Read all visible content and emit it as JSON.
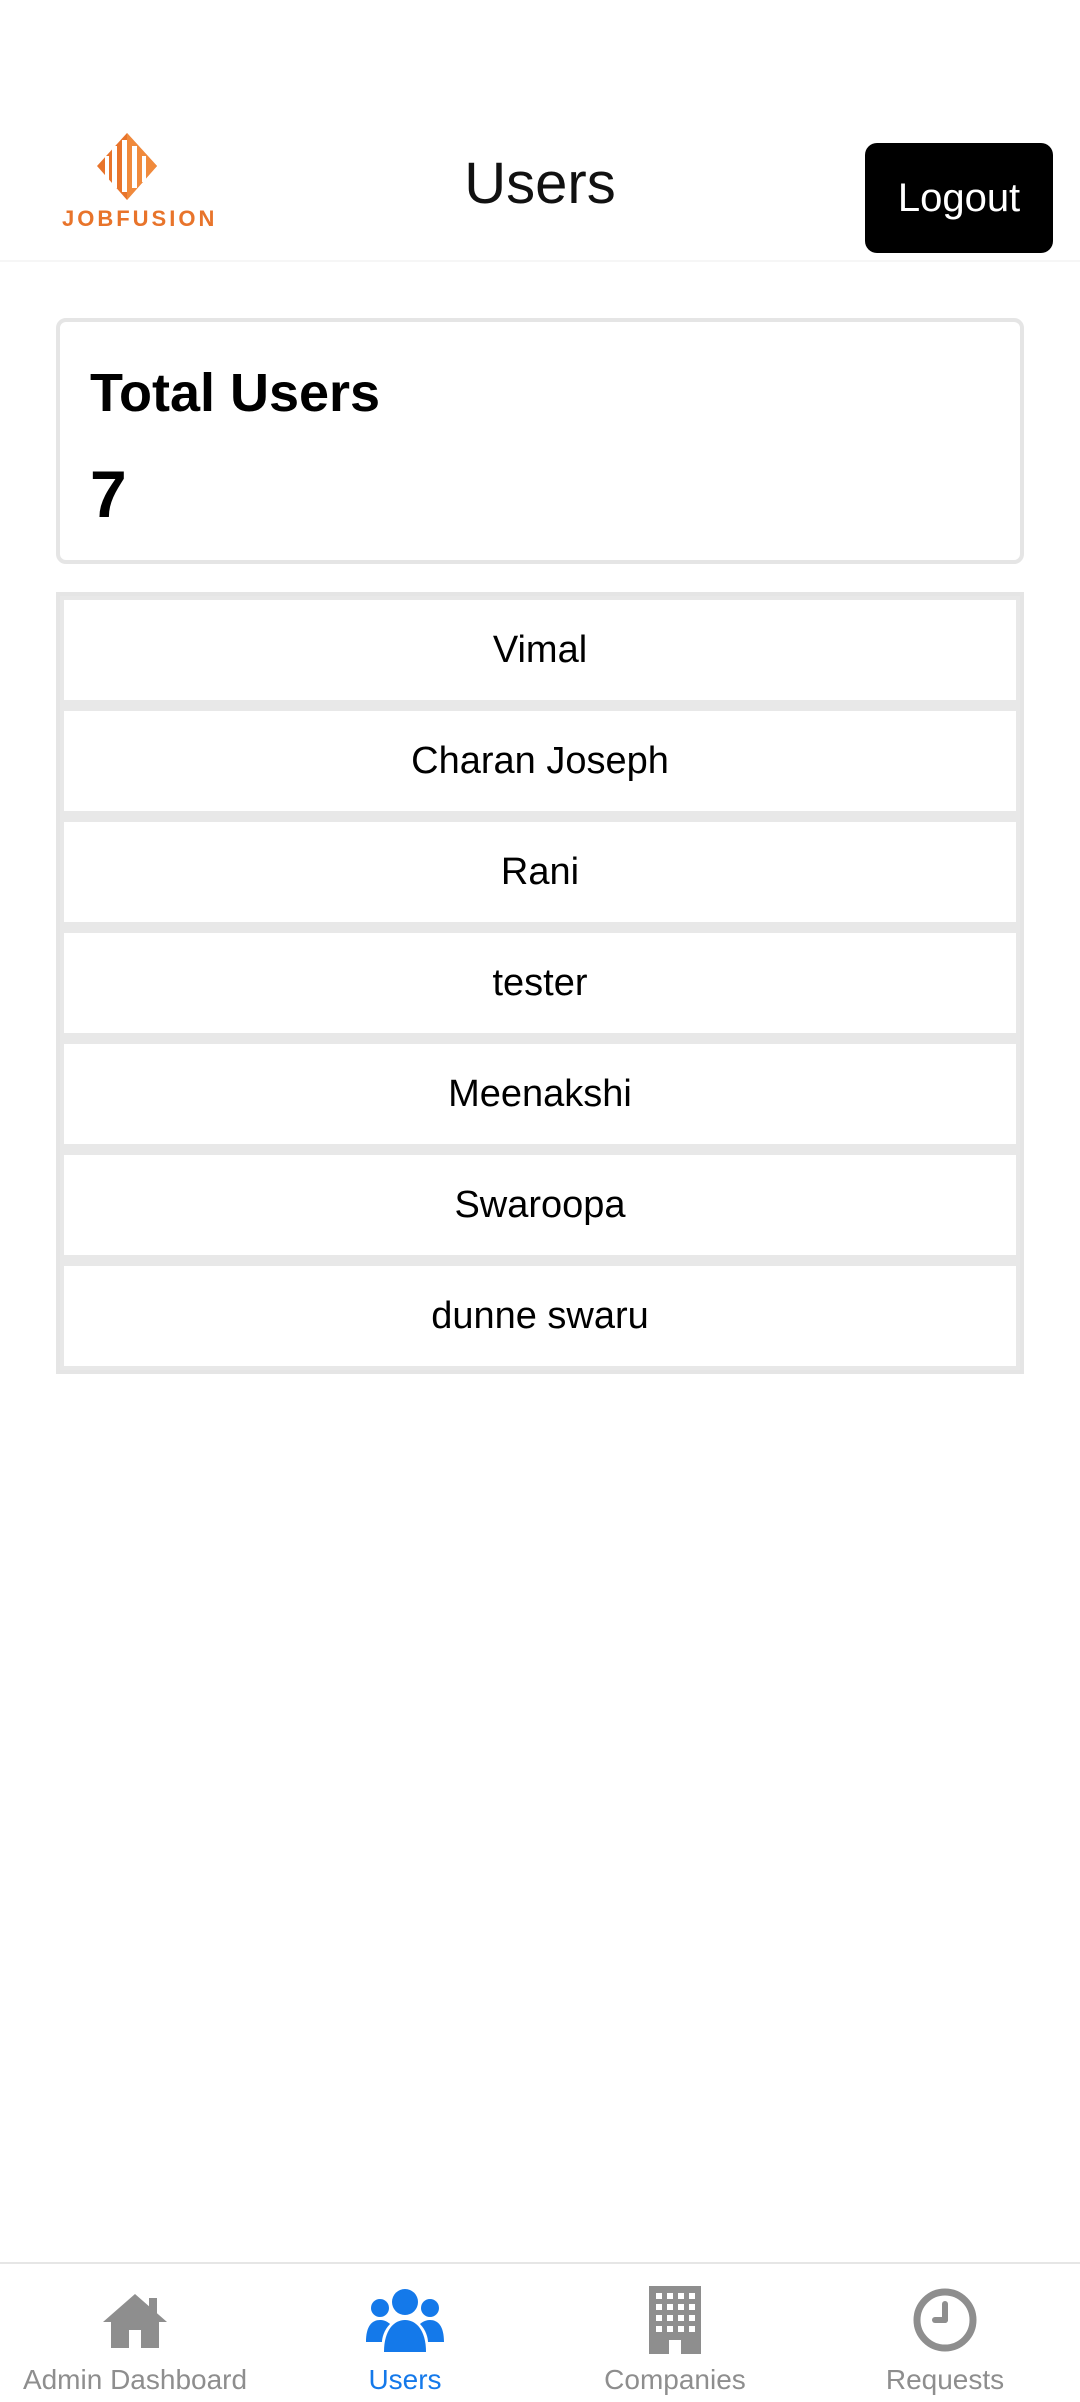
{
  "header": {
    "logo_text": "JOBFUSION",
    "title": "Users",
    "logout_label": "Logout"
  },
  "stats": {
    "label": "Total Users",
    "value": "7"
  },
  "users": [
    {
      "name": "Vimal"
    },
    {
      "name": "Charan Joseph"
    },
    {
      "name": "Rani"
    },
    {
      "name": "tester"
    },
    {
      "name": "Meenakshi"
    },
    {
      "name": "Swaroopa"
    },
    {
      "name": "dunne swaru"
    }
  ],
  "nav": {
    "items": [
      {
        "label": "Admin Dashboard",
        "icon": "home-icon"
      },
      {
        "label": "Users",
        "icon": "users-icon",
        "active": true
      },
      {
        "label": "Companies",
        "icon": "building-icon"
      },
      {
        "label": "Requests",
        "icon": "clock-icon"
      }
    ],
    "active_color": "#1479ea",
    "inactive_color": "#8e8e8e"
  },
  "colors": {
    "logo": "#e8742b",
    "button_bg": "#000000"
  }
}
